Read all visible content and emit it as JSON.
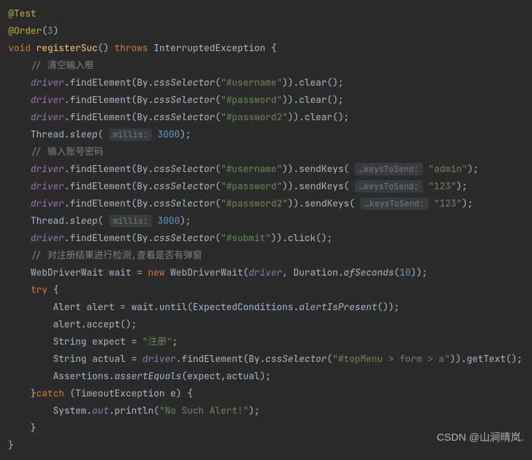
{
  "ann1": "@Test",
  "ann2a": "@Order",
  "ann2b": "(",
  "ann2num": "3",
  "ann2c": ")",
  "sig_void": "void ",
  "sig_name": "registerSuc",
  "sig_p1": "() ",
  "sig_throws": "throws ",
  "sig_exc": "InterruptedException {",
  "cmt_clear": "// 清空输入框",
  "drv": "driver",
  "fe": ".findElement(By.",
  "css": "cssSelector",
  "op": "(",
  "s_user": "\"#username\"",
  "s_pass": "\"#password\"",
  "s_pass2": "\"#password2\"",
  "s_submit": "\"#submit\"",
  "s_top": "\"#topMenu > form > a\"",
  "clr": ")).clear();",
  "thread": "Thread.",
  "sleep": "sleep",
  "pa": "( ",
  "hint_millis": "millis:",
  "sp": " ",
  "n3000": "3000",
  "pe": ");",
  "cmt_input": "// 输入账号密码",
  "sk": ")).sendKeys( ",
  "hint_keys": "…keysToSend:",
  "s_admin": "\"admin\"",
  "s_123": "\"123\"",
  "skend": ");",
  "clk": ")).click();",
  "cmt_check": "// 对注册结果进行检测,查看是否有弹窗",
  "wdw1": "WebDriverWait wait = ",
  "new": "new ",
  "wdw2": "WebDriverWait(",
  "dur": ", Duration.",
  "ofs": "ofSeconds",
  "n10": "10",
  "wdwend": "));",
  "try": "try ",
  "ob": "{",
  "alert1": "Alert alert = wait.until(ExpectedConditions.",
  "aip": "alertIsPresent",
  "alert2": "());",
  "accept": "alert.accept();",
  "expect1": "String expect = ",
  "s_reg": "\"注册\"",
  "semi": ";",
  "actual1": "String actual = ",
  "actual2": ".findElement(By.",
  "gt": ")).getText();",
  "assert1": "Assertions.",
  "assertEq": "assertEquals",
  "assert2": "(expect,actual);",
  "cb": "}",
  "catch": "catch ",
  "catch2": "(TimeoutException e) {",
  "sysout1": "System.",
  "out": "out",
  "sysout2": ".println(",
  "s_no": "\"No Such Alert!\"",
  "watermark": "CSDN @山涧晴岚."
}
